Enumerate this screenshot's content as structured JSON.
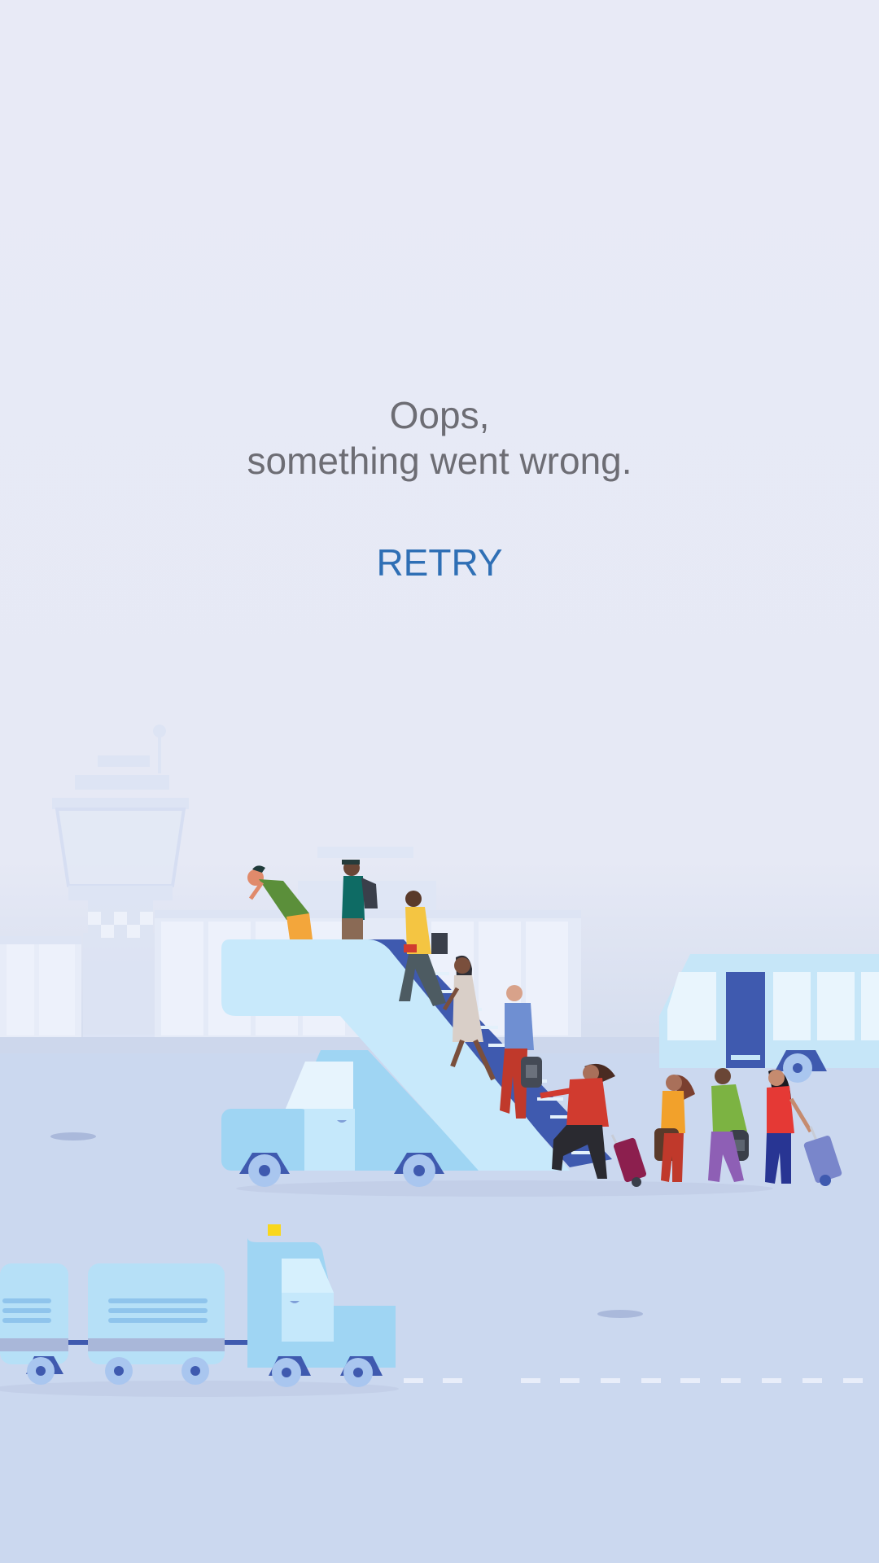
{
  "error": {
    "line1": "Oops,",
    "line2": "something went wrong."
  },
  "actions": {
    "retry_label": "RETRY"
  },
  "illustration": {
    "subject": "airport-boarding-scene",
    "colors": {
      "background_top": "#e8eaf6",
      "ground": "#cbd8ef",
      "vehicle_light": "#a9d8f3",
      "vehicle_dark": "#3f5aaf",
      "text": "#6d6d74",
      "accent": "#2f6fb5"
    }
  }
}
